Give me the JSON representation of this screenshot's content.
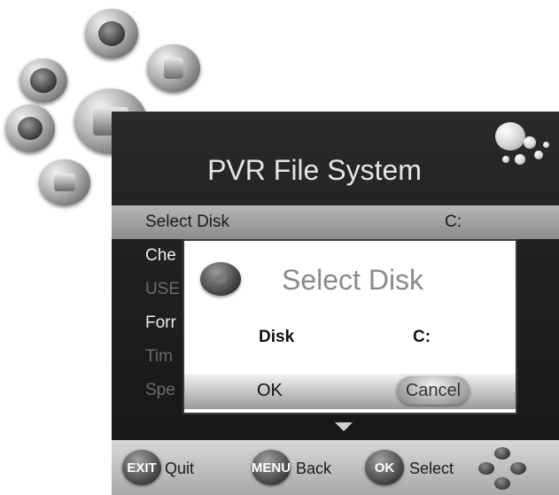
{
  "panel": {
    "title": "PVR File System"
  },
  "menu": {
    "items": [
      {
        "label": "Select Disk",
        "value": "C:"
      },
      {
        "label": "Che"
      },
      {
        "label": "USE"
      },
      {
        "label": "Forr"
      },
      {
        "label": "Tim"
      },
      {
        "label": "Spe"
      }
    ]
  },
  "dialog": {
    "title": "Select Disk",
    "disk_label": "Disk",
    "disk_value": "C:",
    "ok_label": "OK",
    "cancel_label": "Cancel"
  },
  "footer": {
    "exit_key": "EXIT",
    "exit_label": "Quit",
    "menu_key": "MENU",
    "menu_label": "Back",
    "ok_key": "OK",
    "ok_label": "Select"
  },
  "icons": {
    "orbit": [
      "gear-icon",
      "disc-icon",
      "lock-icon",
      "monitor-icon",
      "satellite-icon",
      "camera-icon"
    ],
    "dialog": "info-icon"
  }
}
